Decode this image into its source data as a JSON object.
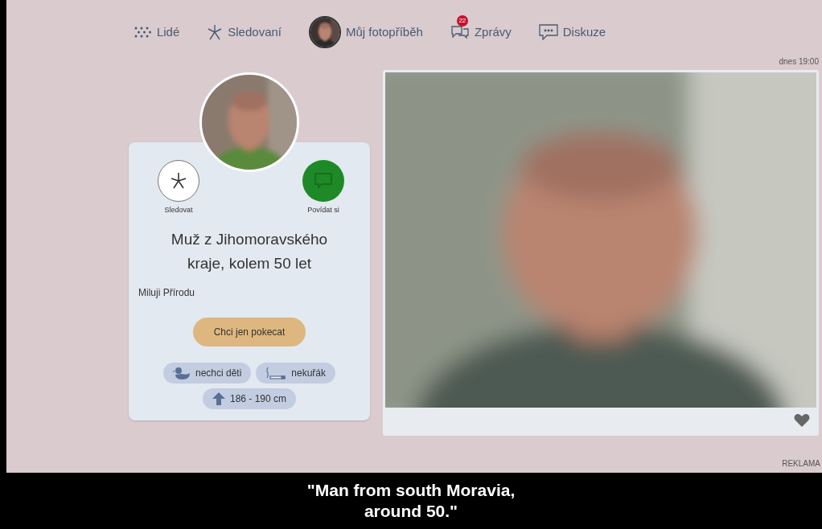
{
  "nav": [
    {
      "label": "Lidé",
      "kind": "people"
    },
    {
      "label": "Sledovaní",
      "kind": "star"
    },
    {
      "label": "Můj fotopříběh",
      "kind": "avatar"
    },
    {
      "label": "Zprávy",
      "kind": "messages",
      "badge": "22"
    },
    {
      "label": "Diskuze",
      "kind": "chat"
    }
  ],
  "profile": {
    "actions": [
      {
        "label": "Sledovat",
        "kind": "follow"
      },
      {
        "label": "Povídat si",
        "kind": "talk"
      }
    ],
    "title": "Muž z Jihomoravského kraje, kolem 50 let",
    "motto": "Miluji Přírodu",
    "intent": "Chci jen pokecat",
    "tags": [
      {
        "label": "nechci děti",
        "kind": "duck"
      },
      {
        "label": "nekuřák",
        "kind": "cigarette"
      },
      {
        "label": "186 - 190 cm",
        "kind": "height"
      }
    ]
  },
  "post": {
    "time": "dnes 19:00"
  },
  "ad_label": "REKLAMA",
  "subtitle": [
    "\"Man from south Moravia,",
    "around 50.\""
  ]
}
